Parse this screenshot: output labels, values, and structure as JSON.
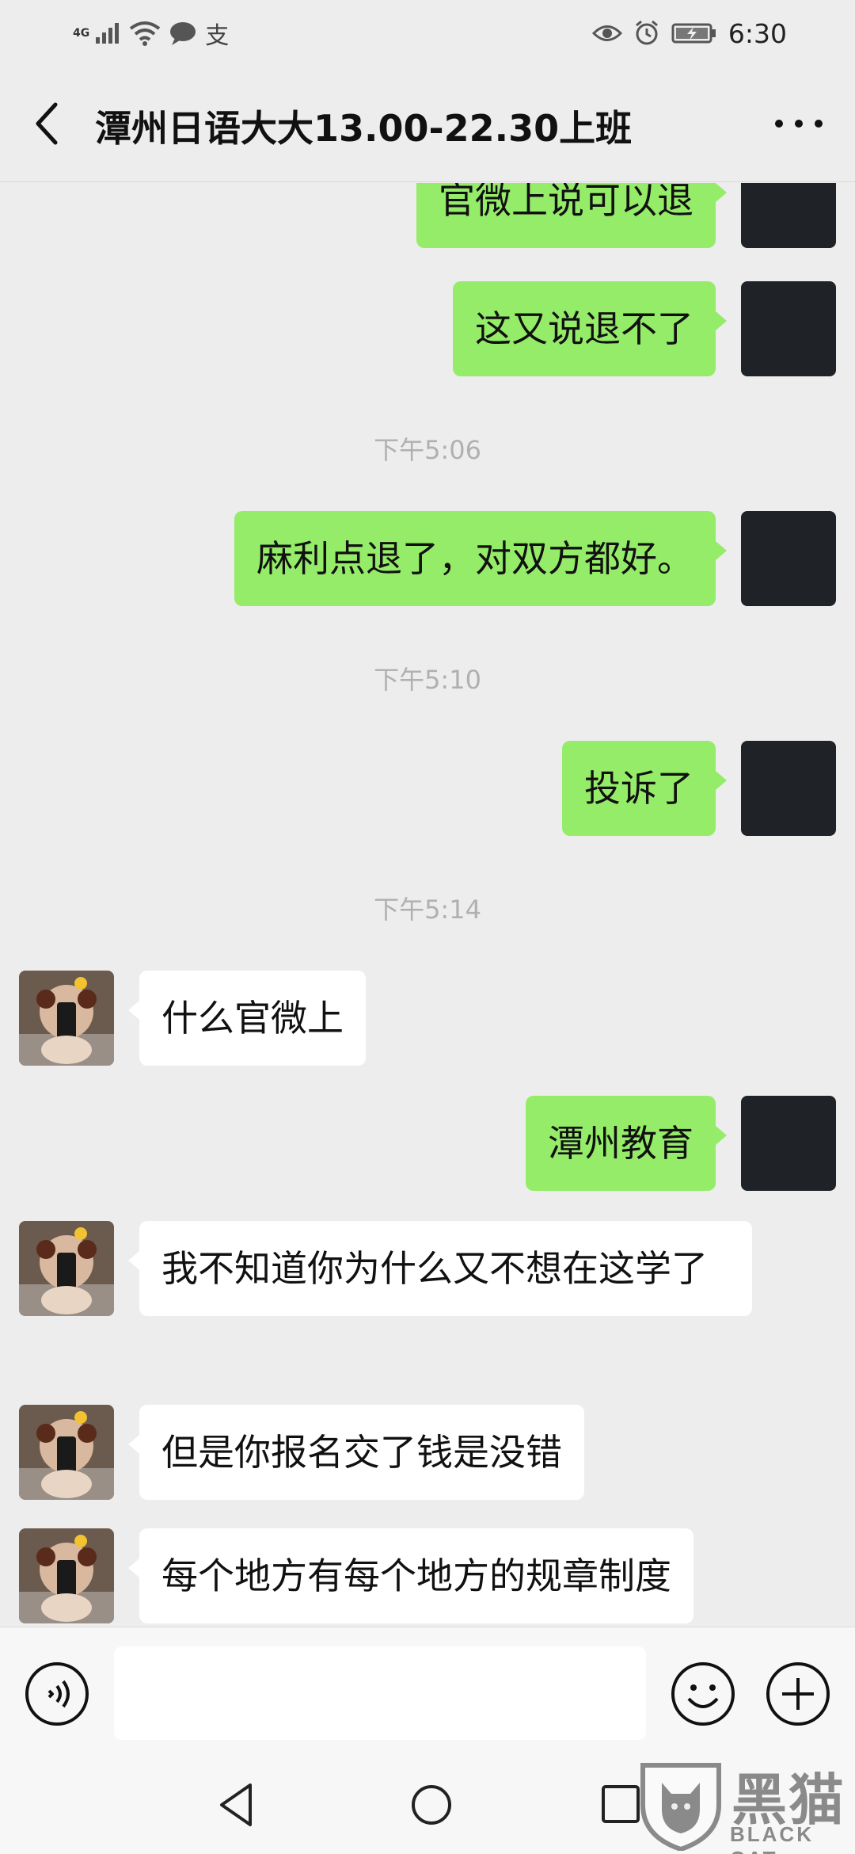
{
  "status_bar": {
    "network": "4G",
    "time": "6:30",
    "icons": [
      "signal-icon",
      "wifi-icon",
      "message-notification-icon",
      "alipay-icon",
      "eye-comfort-icon",
      "alarm-icon",
      "battery-charging-icon"
    ],
    "alipay_glyph": "支"
  },
  "header": {
    "title": "潭州日语大大13.00-22.30上班",
    "back_icon": "chevron-left-icon",
    "more_icon": "more-dots-icon"
  },
  "messages": [
    {
      "id": "m1",
      "from": "self",
      "text": "官微上说可以退"
    },
    {
      "id": "m2",
      "from": "self",
      "text": "这又说退不了"
    },
    {
      "id": "t1",
      "type": "time",
      "text": "下午5:06"
    },
    {
      "id": "m3",
      "from": "self",
      "text": "麻利点退了，对双方都好。"
    },
    {
      "id": "t2",
      "type": "time",
      "text": "下午5:10"
    },
    {
      "id": "m4",
      "from": "self",
      "text": "投诉了"
    },
    {
      "id": "t3",
      "type": "time",
      "text": "下午5:14"
    },
    {
      "id": "m5",
      "from": "other",
      "text": "什么官微上"
    },
    {
      "id": "m6",
      "from": "self",
      "text": "潭州教育"
    },
    {
      "id": "m7",
      "from": "other",
      "text": "我不知道你为什么又不想在这学了"
    },
    {
      "id": "m8",
      "from": "other",
      "text": "但是你报名交了钱是没错"
    },
    {
      "id": "m9",
      "from": "other",
      "text": "每个地方有每个地方的规章制度"
    }
  ],
  "input_bar": {
    "value": "",
    "placeholder": ""
  },
  "watermark": {
    "chinese": "黑猫",
    "english": "BLACK CAT"
  },
  "colors": {
    "outgoing_bubble": "#95ec69",
    "incoming_bubble": "#ffffff",
    "background": "#ededed",
    "timestamp": "#b0b0b0"
  }
}
